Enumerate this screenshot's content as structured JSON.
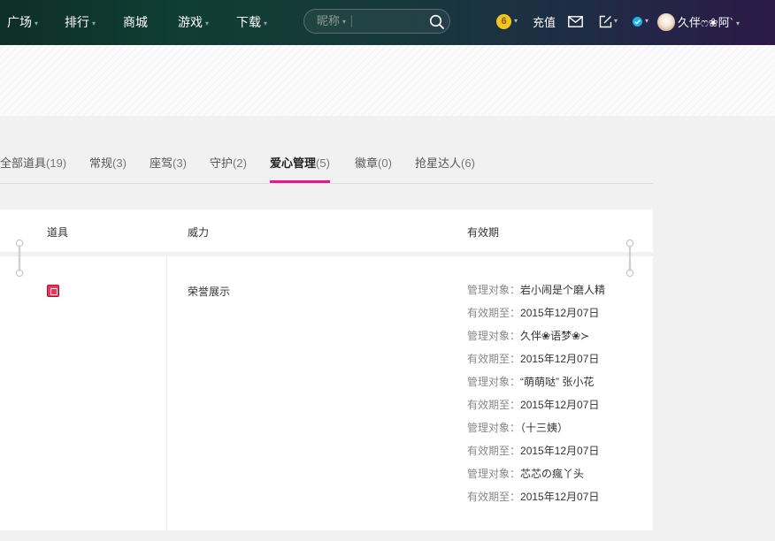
{
  "topbar": {
    "nav": [
      {
        "label": "广场",
        "has_caret": true
      },
      {
        "label": "排行",
        "has_caret": true
      },
      {
        "label": "商城",
        "has_caret": false
      },
      {
        "label": "游戏",
        "has_caret": true
      },
      {
        "label": "下载",
        "has_caret": true
      }
    ],
    "search": {
      "scope": "昵称",
      "placeholder": ""
    },
    "coin_level": "6",
    "recharge_label": "充值",
    "username": "久伴ෆ❀阿`",
    "caret_glyph": "▾"
  },
  "tabs": [
    {
      "label": "全部道具",
      "count": "(19)",
      "active": false
    },
    {
      "label": "常规",
      "count": "(3)",
      "active": false
    },
    {
      "label": "座驾",
      "count": "(3)",
      "active": false
    },
    {
      "label": "守护",
      "count": "(2)",
      "active": false
    },
    {
      "label": "爱心管理",
      "count": "(5)",
      "active": true
    },
    {
      "label": "徽章",
      "count": "(0)",
      "active": false
    },
    {
      "label": "抢星达人",
      "count": "(6)",
      "active": false
    }
  ],
  "table": {
    "headers": {
      "item": "道具",
      "power": "威力",
      "expiry": "有效期"
    },
    "rows": [
      {
        "item_icon": "love-manage-icon",
        "power": "荣誉展示",
        "details": [
          {
            "label": "管理对象：",
            "value": "岩小闹是个磨人精"
          },
          {
            "label": "有效期至：",
            "value": "2015年12月07日"
          },
          {
            "label": "管理对象：",
            "value": "久伴❀语梦❀≻"
          },
          {
            "label": "有效期至：",
            "value": "2015年12月07日"
          },
          {
            "label": "管理对象：",
            "value": "“萌萌哒” 张小花"
          },
          {
            "label": "有效期至：",
            "value": "2015年12月07日"
          },
          {
            "label": "管理对象：",
            "value": "（十三姨）"
          },
          {
            "label": "有效期至：",
            "value": "2015年12月07日"
          },
          {
            "label": "管理对象：",
            "value": "芯芯の瘋丫头"
          },
          {
            "label": "有效期至：",
            "value": "2015年12月07日"
          }
        ]
      }
    ]
  },
  "colors": {
    "active_tab_underline": "#e6178f",
    "coin": "#f4c51d",
    "verified": "#1ab1e6"
  }
}
